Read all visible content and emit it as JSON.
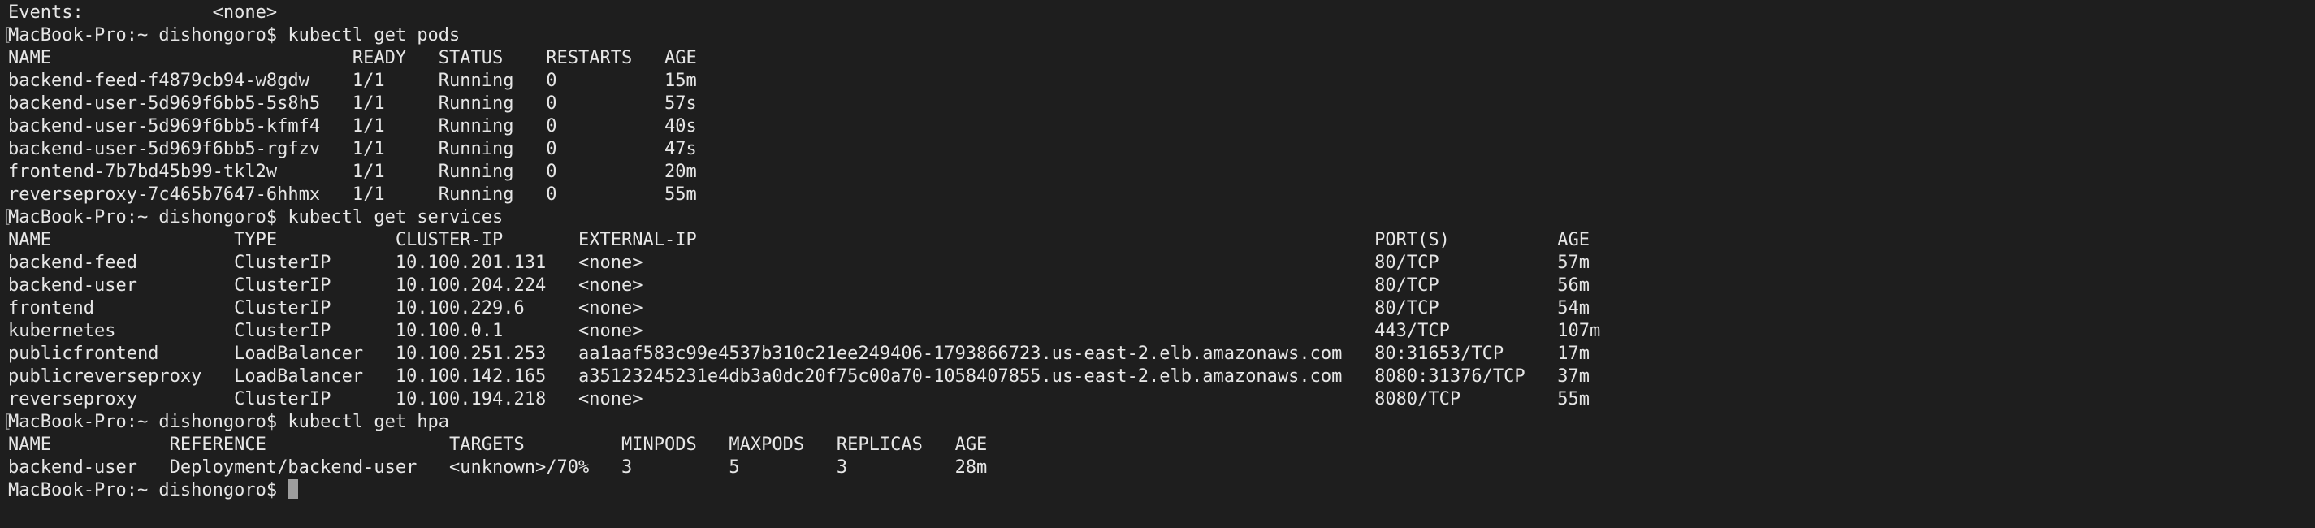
{
  "terminal": {
    "prompt": "MacBook-Pro:~ dishongoro$ ",
    "lines": [
      "Events:            <none>",
      "MacBook-Pro:~ dishongoro$ kubectl get pods",
      "NAME                            READY   STATUS    RESTARTS   AGE",
      "backend-feed-f4879cb94-w8gdw    1/1     Running   0          15m",
      "backend-user-5d969f6bb5-5s8h5   1/1     Running   0          57s",
      "backend-user-5d969f6bb5-kfmf4   1/1     Running   0          40s",
      "backend-user-5d969f6bb5-rgfzv   1/1     Running   0          47s",
      "frontend-7b7bd45b99-tkl2w       1/1     Running   0          20m",
      "reverseproxy-7c465b7647-6hhmx   1/1     Running   0          55m",
      "MacBook-Pro:~ dishongoro$ kubectl get services",
      "NAME                 TYPE           CLUSTER-IP       EXTERNAL-IP                                                               PORT(S)          AGE",
      "backend-feed         ClusterIP      10.100.201.131   <none>                                                                    80/TCP           57m",
      "backend-user         ClusterIP      10.100.204.224   <none>                                                                    80/TCP           56m",
      "frontend             ClusterIP      10.100.229.6     <none>                                                                    80/TCP           54m",
      "kubernetes           ClusterIP      10.100.0.1       <none>                                                                    443/TCP          107m",
      "publicfrontend       LoadBalancer   10.100.251.253   aa1aaf583c99e4537b310c21ee249406-1793866723.us-east-2.elb.amazonaws.com   80:31653/TCP     17m",
      "publicreverseproxy   LoadBalancer   10.100.142.165   a35123245231e4db3a0dc20f75c00a70-1058407855.us-east-2.elb.amazonaws.com   8080:31376/TCP   37m",
      "reverseproxy         ClusterIP      10.100.194.218   <none>                                                                    8080/TCP         55m",
      "MacBook-Pro:~ dishongoro$ kubectl get hpa",
      "NAME           REFERENCE                 TARGETS         MINPODS   MAXPODS   REPLICAS   AGE",
      "backend-user   Deployment/backend-user   <unknown>/70%   3         5         3          28m"
    ]
  }
}
